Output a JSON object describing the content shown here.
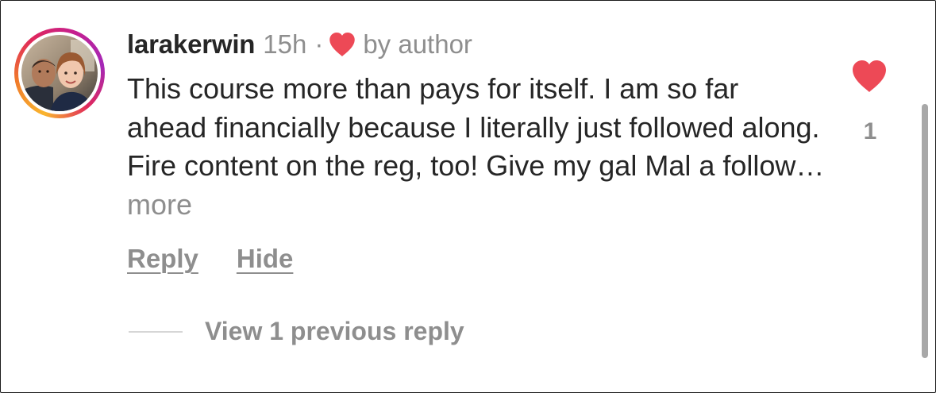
{
  "comment": {
    "username": "larakerwin",
    "time": "15h",
    "separator": "·",
    "author_tag": "by author",
    "text": "This course more than pays for itself. I am so far ahead financially because I literally just followed along. Fire content on the reg, too! Give my gal Mal a follow…",
    "more_label": "more",
    "like_count": "1",
    "liked": true,
    "liked_by_author": true
  },
  "actions": {
    "reply_label": "Reply",
    "hide_label": "Hide"
  },
  "replies": {
    "view_label": "View 1 previous reply"
  },
  "colors": {
    "heart": "#ed4956",
    "text": "#262626",
    "secondary": "#8e8e8e",
    "story_ring_start": "#f9b52e",
    "story_ring_end": "#c51f8f"
  },
  "icons": {
    "like": "heart-filled-icon",
    "author_like": "heart-filled-icon",
    "avatar": "profile-photo"
  }
}
